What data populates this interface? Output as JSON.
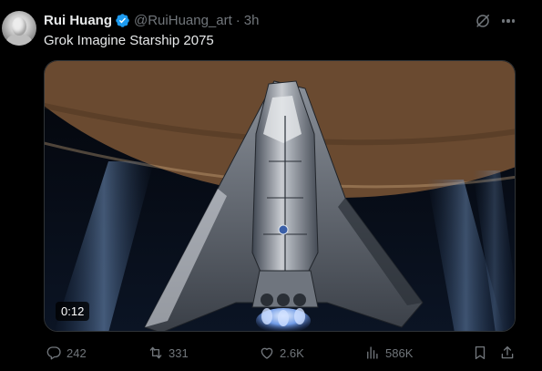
{
  "tweet": {
    "author_name": "Rui Huang",
    "handle": "@RuiHuang_art",
    "separator": "·",
    "time": "3h",
    "text": "Grok Imagine Starship 2075",
    "verified_color": "#1d9bf0"
  },
  "media": {
    "type": "video",
    "duration": "0:12"
  },
  "actions": {
    "replies": "242",
    "reposts": "331",
    "likes": "2.6K",
    "views": "586K"
  },
  "icons": {
    "grok": "grok-icon",
    "more": "more-icon",
    "reply": "reply-icon",
    "repost": "repost-icon",
    "like": "heart-icon",
    "views": "views-icon",
    "bookmark": "bookmark-icon",
    "share": "share-icon"
  }
}
